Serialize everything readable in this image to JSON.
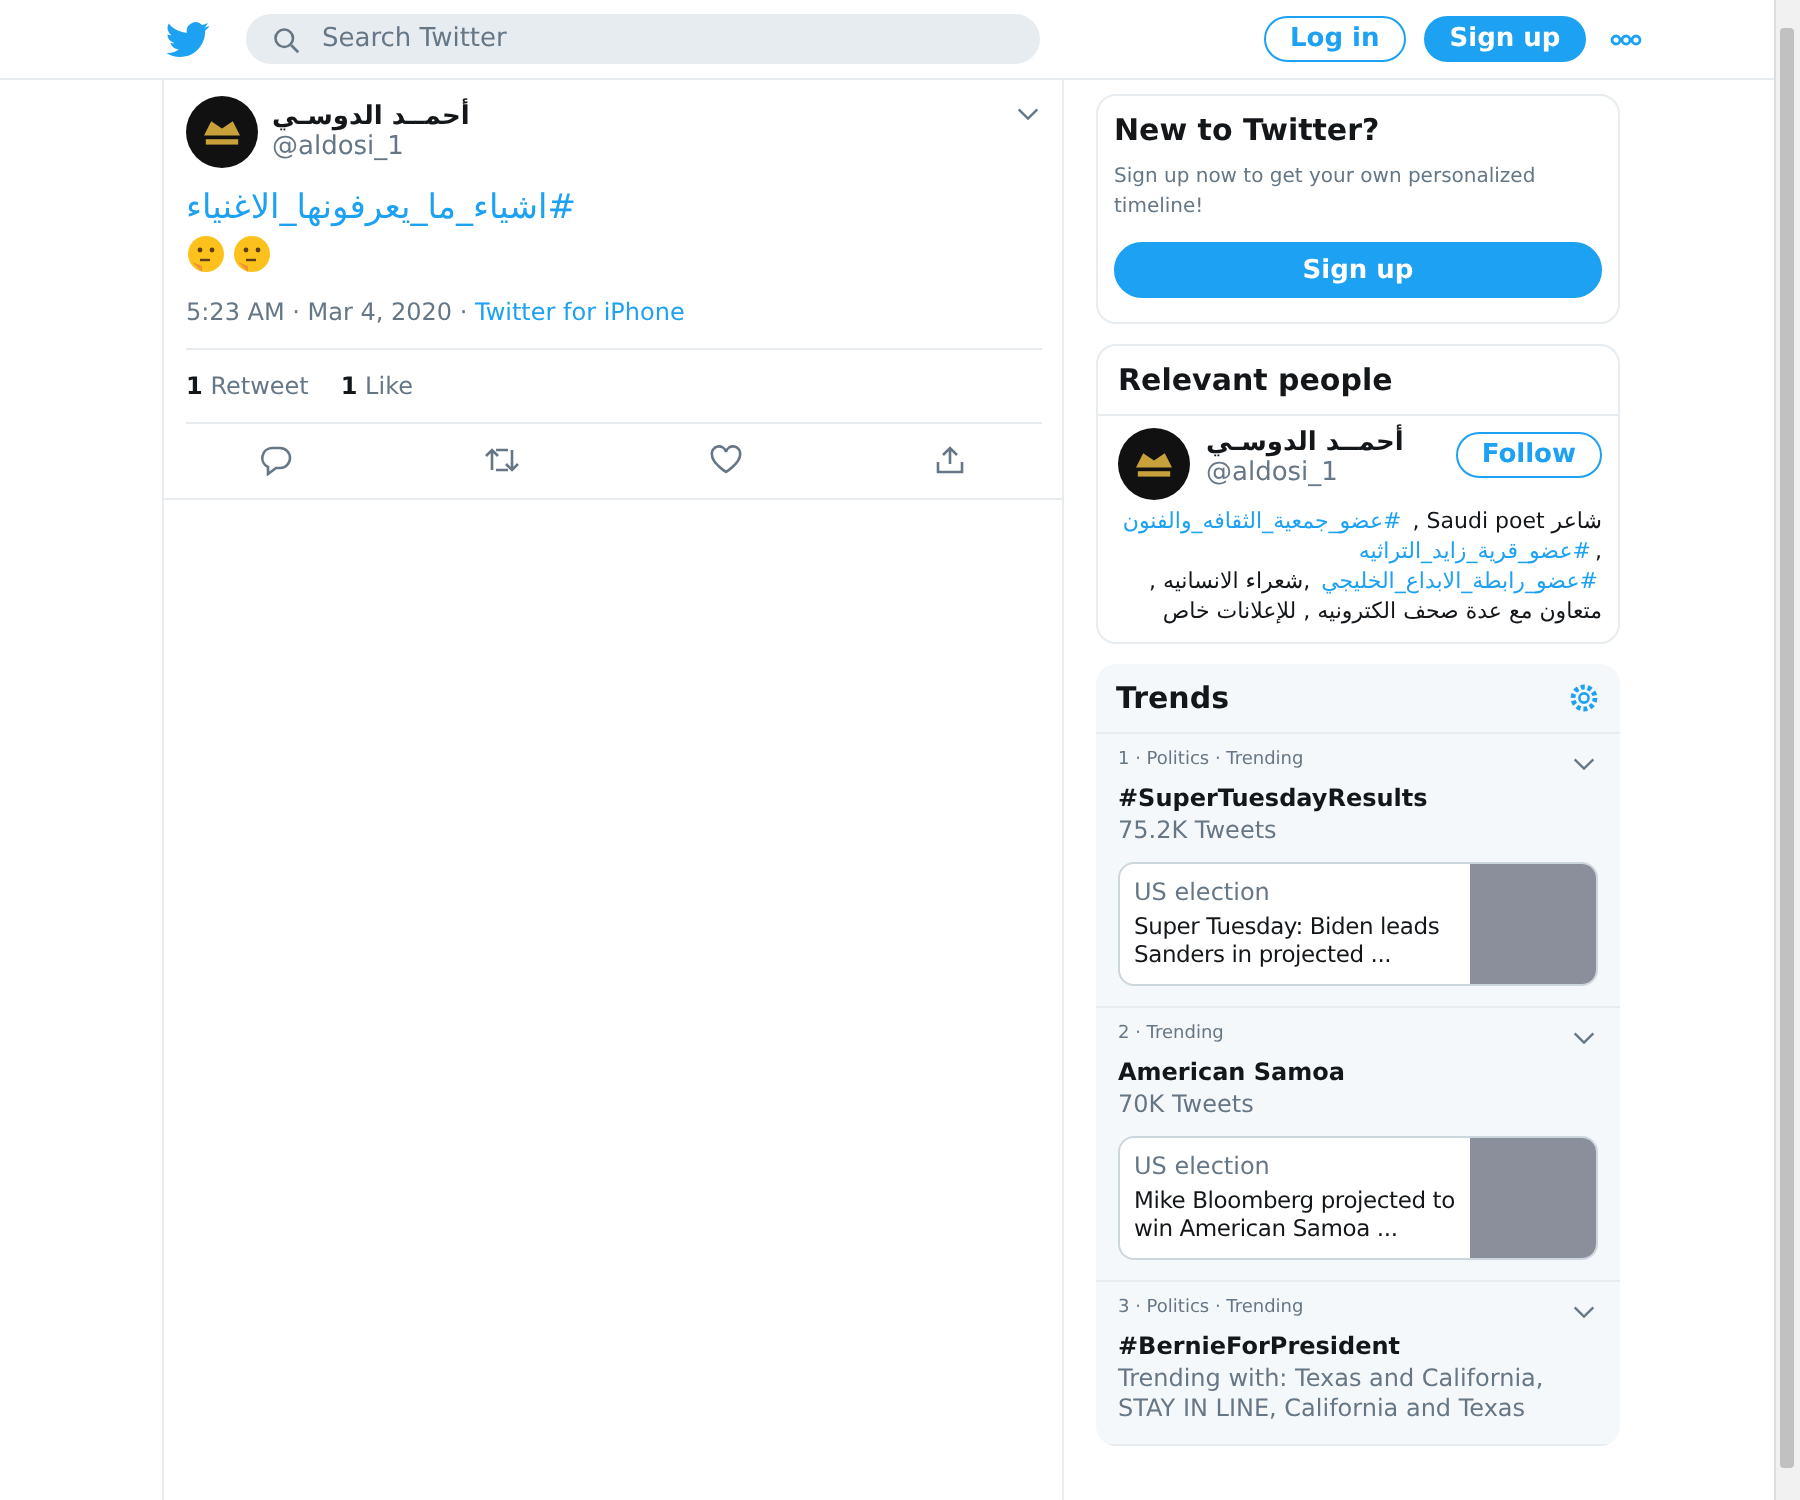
{
  "topbar": {
    "search": {
      "placeholder": "Search Twitter"
    },
    "login": "Log in",
    "signup": "Sign up"
  },
  "tweet": {
    "name": "أحمــد الدوسـي",
    "handle": "@aldosi_1",
    "hashtag": "#اشياء_ما_يعرفونها_الاغنياء",
    "time": "5:23 AM · Mar 4, 2020 · ",
    "source": "Twitter for iPhone",
    "stats": [
      {
        "count": "1",
        "label": "Retweet"
      },
      {
        "count": "1",
        "label": "Like"
      }
    ]
  },
  "new_to_twitter": {
    "title": "New to Twitter?",
    "text": "Sign up now to get your own personalized timeline!",
    "button": "Sign up"
  },
  "relevant_people": {
    "title": "Relevant people",
    "name": "أحمــد الدوسـي",
    "handle": "@aldosi_1",
    "follow": "Follow",
    "bio": [
      {
        "kind": "text",
        "text": "شاعر Saudi poet , "
      },
      {
        "kind": "link",
        "text": "#عضو_جمعية_الثقافه_والفنون"
      },
      {
        "kind": "text",
        "text": " ,"
      },
      {
        "kind": "link",
        "text": "#عضو_قرية_زايد_التراثيه"
      },
      {
        "kind": "link",
        "text": "#عضو_رابطة_الابداع_الخليجي"
      },
      {
        "kind": "text",
        "text": " ,شعراء الانسانيه , متعاون مع عدة صحف الكترونيه , للإعلانات خاص"
      }
    ]
  },
  "trends": {
    "title": "Trends",
    "items": [
      {
        "meta": "1 · Politics · Trending",
        "name": "#SuperTuesdayResults",
        "sub": "75.2K Tweets",
        "card": {
          "label": "US election",
          "text": "Super Tuesday: Biden leads Sanders in projected ..."
        }
      },
      {
        "meta": "2 · Trending",
        "name": "American Samoa",
        "sub": "70K Tweets",
        "card": {
          "label": "US election",
          "text": "Mike Bloomberg projected to win American Samoa ..."
        }
      },
      {
        "meta": "3 · Politics · Trending",
        "name": "#BernieForPresident",
        "sub": "Trending with: Texas and California, STAY IN LINE, California and Texas"
      }
    ]
  }
}
